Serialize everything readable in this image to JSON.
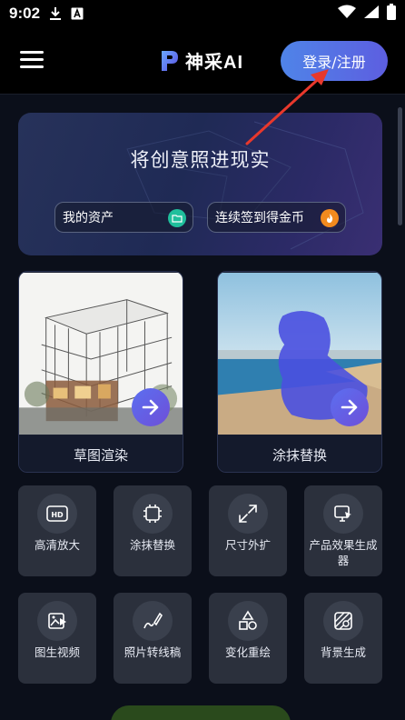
{
  "status_bar": {
    "time": "9:02",
    "left_icons": [
      "download-icon",
      "font-a-icon"
    ],
    "right_icons": [
      "wifi-icon",
      "signal-icon",
      "battery-icon"
    ]
  },
  "app_bar": {
    "menu_icon": "hamburger-menu-icon",
    "logo_text": "神采AI",
    "login_label": "登录/注册"
  },
  "hero": {
    "title": "将创意照进现实",
    "assets_label": "我的资产",
    "checkin_label": "连续签到得金币",
    "assets_icon": "folder-icon",
    "checkin_icon": "flame-icon"
  },
  "feature_cards": [
    {
      "label": "草图渲染",
      "icon": "arrow-right-icon"
    },
    {
      "label": "涂抹替换",
      "icon": "arrow-right-icon"
    }
  ],
  "tools": [
    {
      "label": "高清放大",
      "icon": "hd-icon"
    },
    {
      "label": "涂抹替换",
      "icon": "chip-icon"
    },
    {
      "label": "尺寸外扩",
      "icon": "expand-icon"
    },
    {
      "label": "产品效果生成器",
      "icon": "product-icon"
    },
    {
      "label": "图生视频",
      "icon": "image-video-icon"
    },
    {
      "label": "照片转线稿",
      "icon": "pen-line-icon"
    },
    {
      "label": "变化重绘",
      "icon": "shapes-icon"
    },
    {
      "label": "背景生成",
      "icon": "background-icon"
    }
  ],
  "colors": {
    "background": "#0b0f1a",
    "login_gradient_start": "#4f84e8",
    "login_gradient_end": "#5d5ee0",
    "annotation_arrow": "#e8382c",
    "go_button": "#5b6ff0"
  }
}
